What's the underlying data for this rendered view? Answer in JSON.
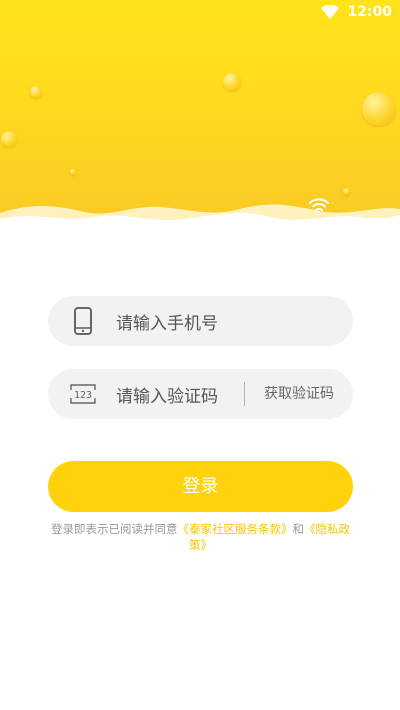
{
  "status_bar": {
    "time": "12:00",
    "wifi_icon": "wifi-icon"
  },
  "colors": {
    "header_top": "#ffe31a",
    "header_bottom": "#f8c626",
    "accent": "#ffd20b",
    "link": "#f4c400",
    "field_bg": "#f2f2f2"
  },
  "phone_field": {
    "icon": "phone-icon",
    "placeholder": "请输入手机号"
  },
  "code_field": {
    "icon": "numeric-123-icon",
    "placeholder": "请输入验证码",
    "get_code_label": "获取验证码"
  },
  "login_button": {
    "label": "登录"
  },
  "agreement": {
    "prefix": "登录即表示已阅读并同意",
    "terms_link": "《泰家社区服务条款》",
    "connector": "和",
    "privacy_link": "《隐私政策》"
  }
}
